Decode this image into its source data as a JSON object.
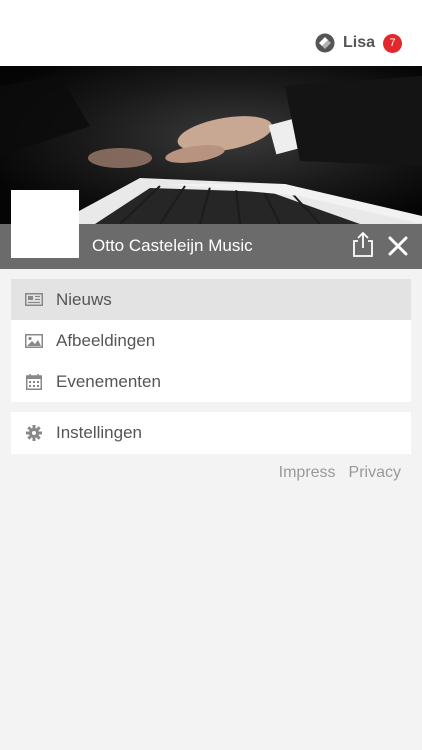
{
  "header": {
    "user_name": "Lisa",
    "notification_count": "7",
    "logo_icon": "app-logo-icon",
    "badge_color": "#e0282d"
  },
  "channel": {
    "title": "Otto Casteleijn Music",
    "share_icon": "share-icon",
    "close_icon": "close-icon"
  },
  "menu": {
    "items": [
      {
        "label": "Nieuws",
        "icon": "newspaper-icon",
        "active": true
      },
      {
        "label": "Afbeeldingen",
        "icon": "image-icon",
        "active": false
      },
      {
        "label": "Evenementen",
        "icon": "calendar-icon",
        "active": false
      }
    ],
    "settings": {
      "label": "Instellingen",
      "icon": "gear-icon"
    }
  },
  "footer_links": {
    "impress": "Impress",
    "privacy": "Privacy"
  }
}
